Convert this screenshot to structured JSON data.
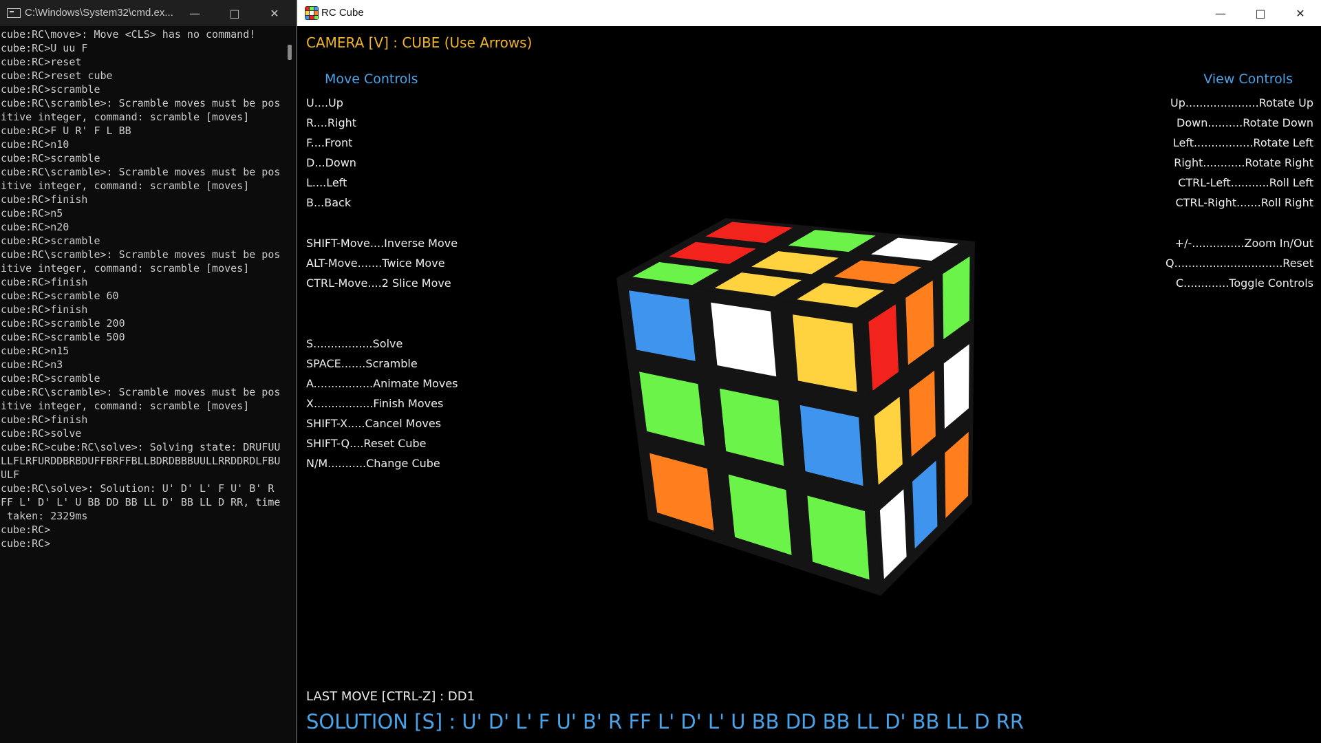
{
  "cmd_window": {
    "title": "C:\\Windows\\System32\\cmd.ex...",
    "lines": [
      "cube:RC\\move>: Move <CLS> has no command!",
      "cube:RC>U uu F",
      "cube:RC>reset",
      "cube:RC>reset cube",
      "cube:RC>scramble",
      "cube:RC\\scramble>: Scramble moves must be pos",
      "itive integer, command: scramble [moves]",
      "cube:RC>F U R' F L BB",
      "cube:RC>n10",
      "cube:RC>scramble",
      "cube:RC\\scramble>: Scramble moves must be pos",
      "itive integer, command: scramble [moves]",
      "cube:RC>finish",
      "cube:RC>n5",
      "cube:RC>n20",
      "cube:RC>scramble",
      "cube:RC\\scramble>: Scramble moves must be pos",
      "itive integer, command: scramble [moves]",
      "cube:RC>finish",
      "cube:RC>scramble 60",
      "cube:RC>finish",
      "cube:RC>scramble 200",
      "cube:RC>scramble 500",
      "cube:RC>n15",
      "cube:RC>n3",
      "cube:RC>scramble",
      "cube:RC\\scramble>: Scramble moves must be pos",
      "itive integer, command: scramble [moves]",
      "cube:RC>finish",
      "cube:RC>solve",
      "cube:RC>cube:RC\\solve>: Solving state: DRUFUU",
      "LLFLRFURDDBRBDUFFBRFFBLLBDRDBBBUULLRRDDRDLFBU",
      "ULF",
      "cube:RC\\solve>: Solution: U' D' L' F U' B' R",
      "FF L' D' L' U BB DD BB LL D' BB LL D RR, time",
      " taken: 2329ms",
      "",
      "cube:RC>",
      "cube:RC>"
    ]
  },
  "rc_window": {
    "title": "RC Cube",
    "camera_label": "CAMERA [V] : CUBE (Use Arrows)",
    "move_controls": {
      "header": "Move Controls",
      "items": [
        "U....Up",
        "R....Right",
        "F....Front",
        "D...Down",
        "L....Left",
        "B...Back",
        "SHIFT-Move....Inverse Move",
        "ALT-Move.......Twice Move",
        "CTRL-Move....2 Slice Move",
        "S.................Solve",
        "SPACE.......Scramble",
        "A.................Animate Moves",
        "X.................Finish Moves",
        "SHIFT-X.....Cancel Moves",
        "SHIFT-Q....Reset Cube",
        "N/M...........Change Cube"
      ]
    },
    "view_controls": {
      "header": "View Controls",
      "items": [
        "Up.....................Rotate Up",
        "Down..........Rotate Down",
        "Left.................Rotate Left",
        "Right............Rotate Right",
        "CTRL-Left...........Roll Left",
        "CTRL-Right.......Roll Right",
        "+/-...............Zoom In/Out",
        "Q...............................Reset",
        "C.............Toggle Controls"
      ]
    },
    "last_move": "LAST MOVE [CTRL-Z] : DD1",
    "solution": "SOLUTION [S] : U' D' L' F U' B' R FF L' D' L' U BB DD BB LL D' BB LL D RR"
  },
  "cube": {
    "colors": {
      "white": "#ffffff",
      "yellow": "#ffd23f",
      "red": "#f2231d",
      "orange": "#ff7f1e",
      "blue": "#3f94ee",
      "green": "#6cf34a"
    },
    "top_face": [
      [
        "red",
        "green",
        "white"
      ],
      [
        "red",
        "yellow",
        "orange"
      ],
      [
        "green",
        "yellow",
        "yellow"
      ]
    ],
    "front_face": [
      [
        "blue",
        "white",
        "yellow"
      ],
      [
        "green",
        "green",
        "blue"
      ],
      [
        "orange",
        "green",
        "green"
      ]
    ],
    "right_face": [
      [
        "red",
        "orange",
        "green"
      ],
      [
        "yellow",
        "orange",
        "white"
      ],
      [
        "white",
        "blue",
        "orange"
      ]
    ]
  }
}
